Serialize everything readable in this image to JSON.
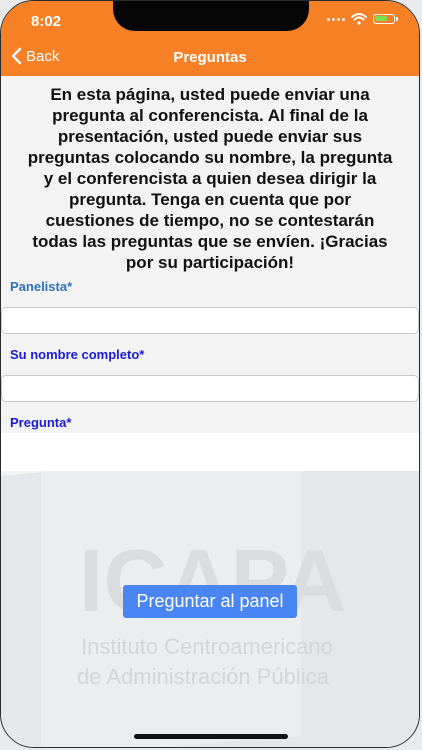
{
  "status_bar": {
    "time": "8:02"
  },
  "nav": {
    "back_label": "Back",
    "title": "Preguntas"
  },
  "intro_text": "En esta página, usted puede enviar una pregunta al conferencista. Al final de la presentación, usted puede enviar sus preguntas colocando su nombre, la pregunta y el conferencista a quien desea dirigir la pregunta. Tenga en cuenta que por cuestiones de tiempo, no se contestarán todas las preguntas que se envíen. ¡Gracias por su participación!",
  "form": {
    "panelista_label": "Panelista*",
    "panelista_value": "",
    "nombre_label": "Su nombre completo*",
    "nombre_value": "",
    "pregunta_label": "Pregunta*",
    "pregunta_value": "",
    "submit_label": "Preguntar al panel"
  },
  "watermark": {
    "acronym": "ICAPA",
    "line1": "Instituto Centroamericano",
    "line2": "de Administración Pública"
  },
  "colors": {
    "header": "#f58025",
    "label_panelista": "#2e73b8",
    "label_other": "#1a1ad6",
    "button": "#4a86f3"
  }
}
